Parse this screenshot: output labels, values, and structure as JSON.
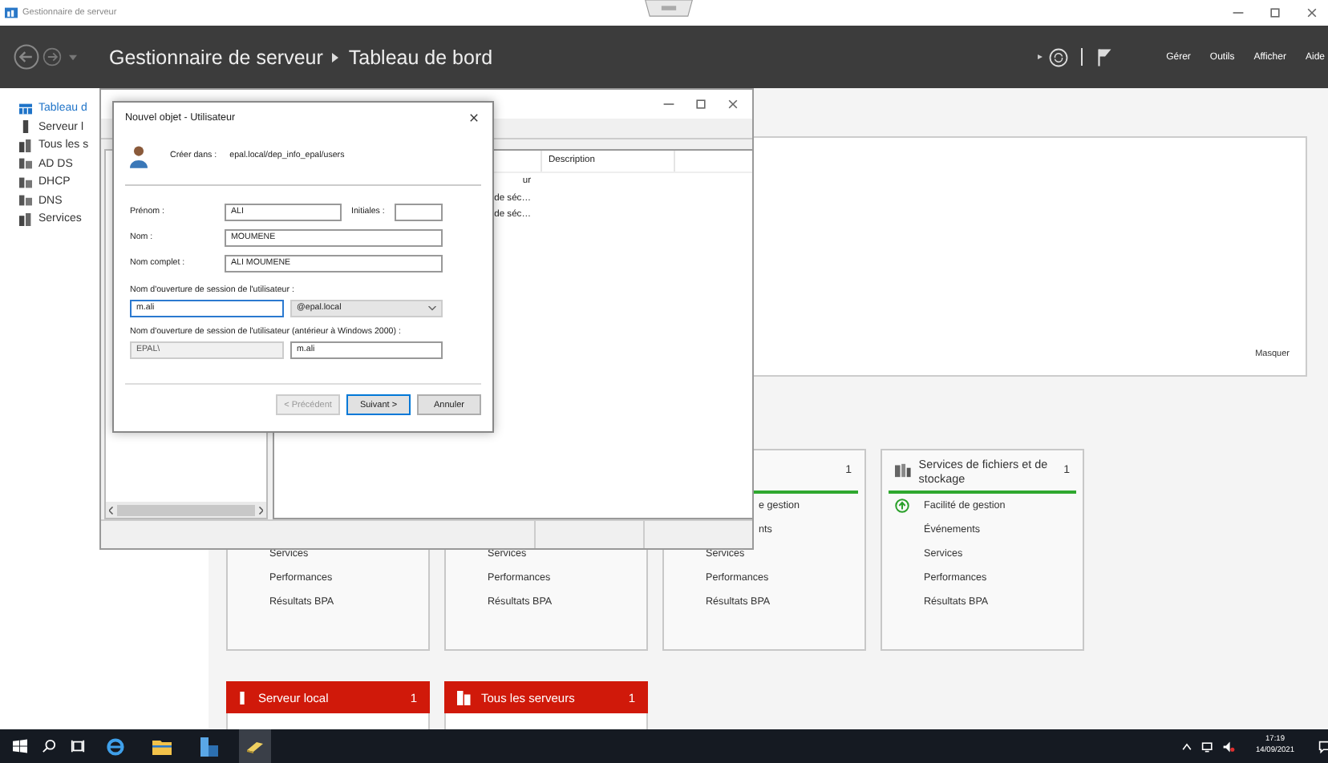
{
  "window": {
    "title": "Gestionnaire de serveur"
  },
  "header": {
    "breadcrumb": [
      "Gestionnaire de serveur",
      "Tableau de bord"
    ],
    "menus": [
      "Gérer",
      "Outils",
      "Afficher",
      "Aide"
    ]
  },
  "sidebar": {
    "items": [
      {
        "label": "Tableau d",
        "kind": "dashboard",
        "selected": true
      },
      {
        "label": "Serveur l",
        "kind": "server",
        "selected": false
      },
      {
        "label": "Tous les s",
        "kind": "servers",
        "selected": false
      },
      {
        "label": "AD DS",
        "kind": "role",
        "selected": false
      },
      {
        "label": "DHCP",
        "kind": "role",
        "selected": false
      },
      {
        "label": "DNS",
        "kind": "role",
        "selected": false
      },
      {
        "label": "Services",
        "kind": "servers",
        "selected": false
      }
    ]
  },
  "welcome_panel": {
    "hide_link": "Masquer"
  },
  "tiles": [
    {
      "items": [
        {
          "label": "Services",
          "kind": "plain"
        },
        {
          "label": "Performances",
          "kind": "plain"
        },
        {
          "label": "Résultats BPA",
          "kind": "plain"
        }
      ]
    },
    {
      "items": [
        {
          "label": "Services",
          "kind": "plain"
        },
        {
          "label": "Performances",
          "kind": "plain"
        },
        {
          "label": "Résultats BPA",
          "kind": "plain"
        }
      ]
    },
    {
      "count": "1",
      "healthy": true,
      "items": [
        {
          "label": "e gestion",
          "kind": "clipped"
        },
        {
          "label": "nts",
          "kind": "clipped"
        },
        {
          "label": "Services",
          "kind": "plain"
        },
        {
          "label": "Performances",
          "kind": "plain"
        },
        {
          "label": "Résultats BPA",
          "kind": "plain"
        }
      ]
    },
    {
      "title": "Services de fichiers et de stockage",
      "count": "1",
      "healthy": true,
      "items": [
        {
          "label": "Facilité de gestion",
          "kind": "status"
        },
        {
          "label": "Événements",
          "kind": "plain"
        },
        {
          "label": "Services",
          "kind": "plain"
        },
        {
          "label": "Performances",
          "kind": "plain"
        },
        {
          "label": "Résultats BPA",
          "kind": "plain"
        }
      ]
    }
  ],
  "server_tiles": [
    {
      "label": "Serveur local",
      "count": "1",
      "kind": "server",
      "alert": true
    },
    {
      "label": "Tous les serveurs",
      "count": "1",
      "kind": "servers",
      "alert": true
    }
  ],
  "ad_window": {
    "list_header": "Description",
    "list_cells": [
      "ur",
      "de séc…",
      "de séc…"
    ]
  },
  "dialog": {
    "title": "Nouvel objet - Utilisateur",
    "location_label": "Créer dans :",
    "location": "epal.local/dep_info_epal/users",
    "first_name": {
      "label": "Prénom :",
      "value": "ALI"
    },
    "initials": {
      "label": "Initiales :"
    },
    "last_name": {
      "label": "Nom :",
      "value": "MOUMENE"
    },
    "full_name": {
      "label": "Nom complet :",
      "value": "ALI MOUMENE"
    },
    "logon": {
      "label": "Nom d'ouverture de session de l'utilisateur :",
      "value": "m.ali",
      "focused": true,
      "domain": "@epal.local"
    },
    "legacy_logon": {
      "label": "Nom d'ouverture de session de l'utilisateur (antérieur à Windows 2000) :",
      "prefix": "EPAL\\",
      "value": "m.ali"
    },
    "buttons": [
      {
        "label": "< Précédent",
        "disabled": true,
        "default": false
      },
      {
        "label": "Suivant >",
        "disabled": false,
        "default": true
      },
      {
        "label": "Annuler",
        "disabled": false,
        "default": false
      }
    ]
  },
  "taskbar": {
    "apps": [
      {
        "kind": "browser",
        "selected": false
      },
      {
        "kind": "folder",
        "selected": false
      },
      {
        "kind": "server-manager",
        "selected": false
      },
      {
        "kind": "tool",
        "selected": true
      }
    ],
    "time": "17:19",
    "date": "14/09/2021"
  }
}
